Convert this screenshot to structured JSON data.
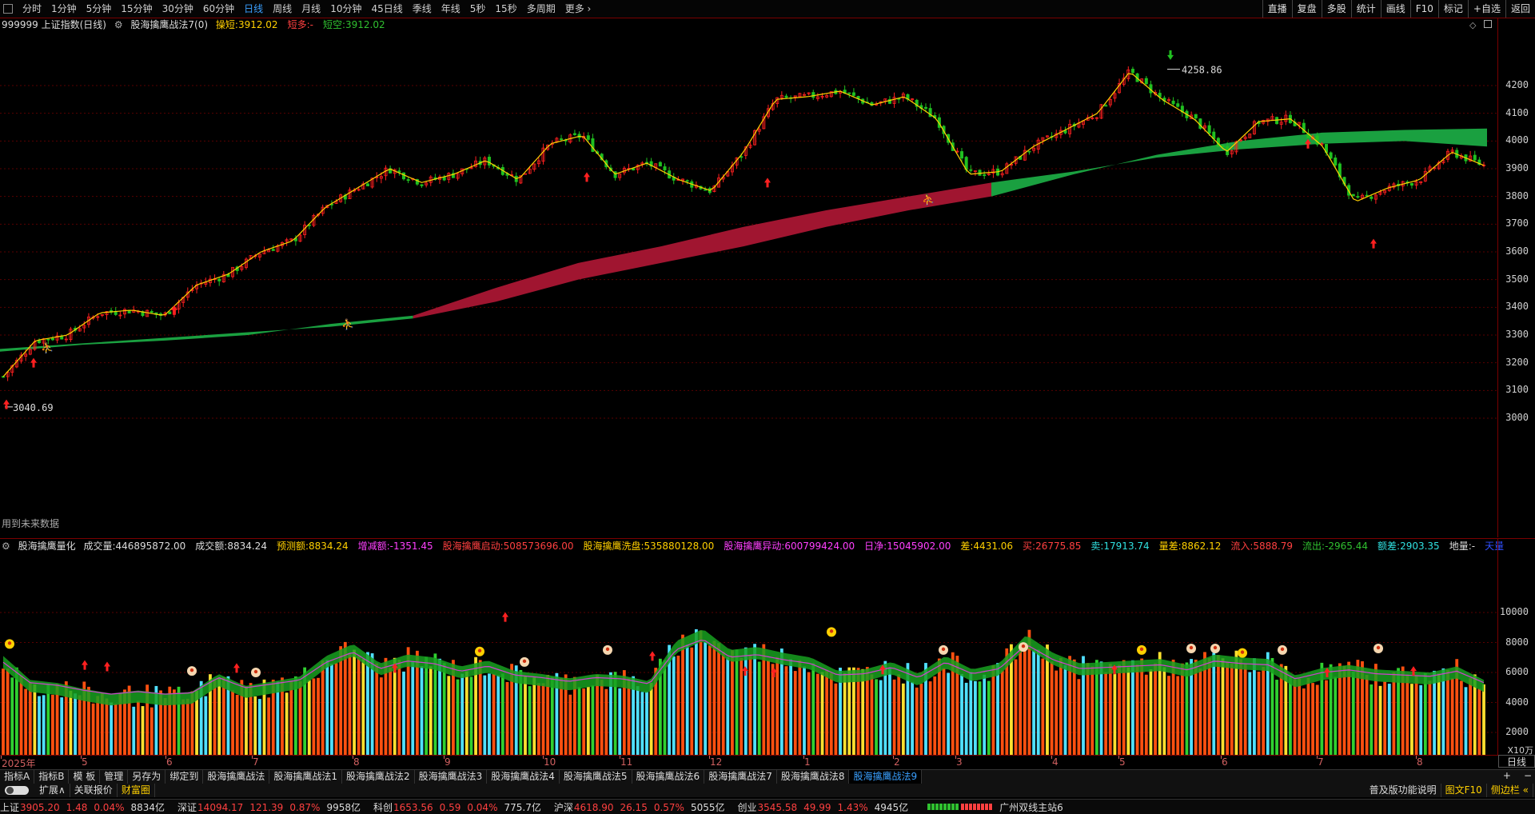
{
  "toolbar": {
    "timeframes": [
      "分时",
      "1分钟",
      "5分钟",
      "15分钟",
      "30分钟",
      "60分钟",
      "日线",
      "周线",
      "月线",
      "10分钟",
      "45日线",
      "季线",
      "年线",
      "5秒",
      "15秒",
      "多周期",
      "更多 ›"
    ],
    "active_timeframe": "日线",
    "right_buttons": [
      "直播",
      "复盘",
      "多股",
      "统计",
      "画线",
      "F10",
      "标记",
      "+自选",
      "返回"
    ]
  },
  "main_info": {
    "symbol": "999999 上证指数(日线)",
    "indicator": "股海擒鹰战法7(0)",
    "items": [
      {
        "label": "操短:",
        "value": "3912.02",
        "color": "#ffd000"
      },
      {
        "label": "短多:",
        "value": "-",
        "color": "#ff4040"
      },
      {
        "label": "短空:",
        "value": "3912.02",
        "color": "#30c030"
      }
    ]
  },
  "annotations": {
    "high_label": "4258.86",
    "low_label": "3040.69",
    "future_note": "用到未来数据"
  },
  "sub_info": {
    "indicator": "股海擒鹰量化",
    "items": [
      {
        "label": "成交量:",
        "value": "446895872.00",
        "color": "#dddddd"
      },
      {
        "label": "成交额:",
        "value": "8834.24",
        "color": "#dddddd"
      },
      {
        "label": "预测额:",
        "value": "8834.24",
        "color": "#ffd000"
      },
      {
        "label": "增减额:",
        "value": "-1351.45",
        "color": "#ff40ff"
      },
      {
        "label": "股海擒鹰启动:",
        "value": "508573696.00",
        "color": "#ff4040"
      },
      {
        "label": "股海擒鹰洗盘:",
        "value": "535880128.00",
        "color": "#ffd000"
      },
      {
        "label": "股海擒鹰异动:",
        "value": "600799424.00",
        "color": "#ff40ff"
      },
      {
        "label": "日净:",
        "value": "15045902.00",
        "color": "#ff40ff"
      },
      {
        "label": "差:",
        "value": "4431.06",
        "color": "#ffd000"
      },
      {
        "label": "买:",
        "value": "26775.85",
        "color": "#ff4040"
      },
      {
        "label": "卖:",
        "value": "17913.74",
        "color": "#30e0e0"
      },
      {
        "label": "量差:",
        "value": "8862.12",
        "color": "#ffd000"
      },
      {
        "label": "流入:",
        "value": "5888.79",
        "color": "#ff4040"
      },
      {
        "label": "流出:",
        "value": "-2965.44",
        "color": "#30c030"
      },
      {
        "label": "额差:",
        "value": "2903.35",
        "color": "#30e0e0"
      },
      {
        "label": "地量:",
        "value": "-",
        "color": "#dddddd"
      },
      {
        "label": "",
        "value": "天量",
        "color": "#3050ff"
      }
    ],
    "unit": "X10万"
  },
  "tabs1": [
    "指标A",
    "指标B",
    "模 板",
    "管理",
    "另存为",
    "绑定到",
    "股海擒鹰战法",
    "股海擒鹰战法1",
    "股海擒鹰战法2",
    "股海擒鹰战法3",
    "股海擒鹰战法4",
    "股海擒鹰战法5",
    "股海擒鹰战法6",
    "股海擒鹰战法7",
    "股海擒鹰战法8",
    "股海擒鹰战法9"
  ],
  "tabs1_active": "股海擒鹰战法9",
  "tabs2": [
    "扩展∧",
    "关联报价",
    "财富圈"
  ],
  "tabs2_right": [
    "普及版功能说明",
    "图文F10",
    "侧边栏 «"
  ],
  "period_button": "日线",
  "status": {
    "markets": [
      {
        "name": "上证",
        "price": "3905.20",
        "chg": "1.48",
        "pct": "0.04%",
        "vol": "8834亿"
      },
      {
        "name": "深证",
        "price": "14094.17",
        "chg": "121.39",
        "pct": "0.87%",
        "vol": "9958亿"
      },
      {
        "name": "科创",
        "price": "1653.56",
        "chg": "0.59",
        "pct": "0.04%",
        "vol": "775.7亿"
      },
      {
        "name": "沪深",
        "price": "4618.90",
        "chg": "26.15",
        "pct": "0.57%",
        "vol": "5055亿"
      },
      {
        "name": "创业",
        "price": "3545.58",
        "chg": "49.99",
        "pct": "1.43%",
        "vol": "4945亿"
      }
    ],
    "server": "广州双线主站6"
  },
  "chart_data": [
    {
      "type": "candlestick",
      "title": "999999 上证指数(日线)",
      "x": [
        "2025-04",
        "2025-05",
        "2025-06",
        "2025-07",
        "2025-08",
        "2025-09",
        "2025-10",
        "2025-11",
        "2025-12",
        "2026-01",
        "2026-02",
        "2026-03",
        "2026-04",
        "2026-05",
        "2026-06",
        "2026-07",
        "2026-08"
      ],
      "close_path": [
        3150,
        3280,
        3300,
        3380,
        3390,
        3370,
        3480,
        3520,
        3600,
        3640,
        3760,
        3830,
        3900,
        3850,
        3880,
        3930,
        3860,
        3990,
        4020,
        3880,
        3920,
        3860,
        3820,
        3960,
        4150,
        4160,
        4180,
        4130,
        4160,
        4080,
        3880,
        3890,
        3980,
        4040,
        4100,
        4250,
        4150,
        4080,
        3960,
        4070,
        4080,
        3980,
        3780,
        3830,
        3860,
        3960,
        3912
      ],
      "ylim": [
        2950,
        4300
      ],
      "yticks": [
        3000,
        3100,
        3200,
        3300,
        3400,
        3500,
        3600,
        3700,
        3800,
        3900,
        4000,
        4100,
        4200
      ],
      "x_tick_labels": [
        "2025年",
        "5",
        "6",
        "7",
        "8",
        "9",
        "10",
        "11",
        "12",
        "1",
        "2",
        "3",
        "4",
        "5",
        "6",
        "7",
        "8"
      ],
      "ribbon_upper": [
        3250,
        3270,
        3290,
        3310,
        3330,
        3360,
        3420,
        3500,
        3560,
        3620,
        3690,
        3750,
        3800,
        3880,
        3950,
        4000,
        4030,
        4040,
        4045
      ],
      "ribbon_lower": [
        3240,
        3265,
        3280,
        3300,
        3340,
        3370,
        3470,
        3560,
        3620,
        3690,
        3750,
        3800,
        3850,
        3890,
        3940,
        3970,
        3990,
        4000,
        3980
      ],
      "high_value": 4258.86,
      "low_value": 3040.69
    },
    {
      "type": "bar",
      "ylabel": "X10万",
      "ylim": [
        0,
        11000
      ],
      "yticks": [
        2000,
        4000,
        6000,
        8000,
        10000
      ],
      "volume_profile": [
        6800,
        5200,
        5000,
        4600,
        4300,
        4500,
        4300,
        4400,
        5600,
        4800,
        5100,
        5400,
        6800,
        7600,
        6300,
        6900,
        6700,
        6100,
        6500,
        5800,
        5600,
        5300,
        5600,
        5500,
        5100,
        7800,
        8600,
        7200,
        7400,
        7000,
        6700,
        5800,
        5900,
        6400,
        5600,
        6800,
        5900,
        6300,
        8200,
        7000,
        6300,
        6400,
        6500,
        6600,
        6200,
        6900,
        6700,
        6600,
        5500,
        6000,
        6200,
        5900,
        5800,
        5700,
        6100,
        5200
      ]
    }
  ]
}
